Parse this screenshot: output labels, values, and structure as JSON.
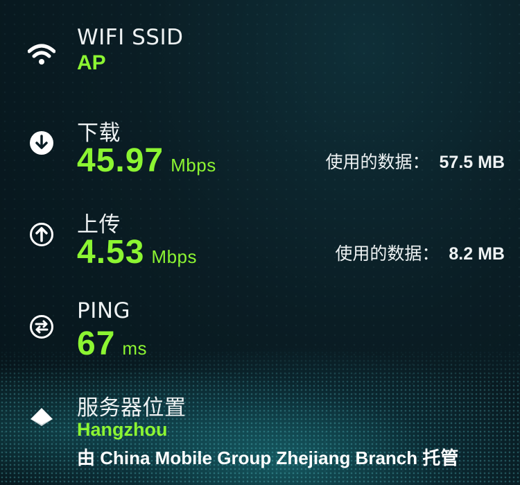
{
  "wifi": {
    "label": "WIFI SSID",
    "ssid": "AP"
  },
  "download": {
    "label": "下载",
    "value": "45.97",
    "unit": "Mbps",
    "used_label": "使用的数据：",
    "used_value": "57.5 MB"
  },
  "upload": {
    "label": "上传",
    "value": "4.53",
    "unit": "Mbps",
    "used_label": "使用的数据：",
    "used_value": "8.2 MB"
  },
  "ping": {
    "label": "PING",
    "value": "67",
    "unit": "ms"
  },
  "server": {
    "label": "服务器位置",
    "city": "Hangzhou",
    "host": "由 China Mobile Group Zhejiang Branch 托管"
  },
  "icons": {
    "wifi": "wifi-icon",
    "download": "download-arrow-icon",
    "upload": "upload-arrow-icon",
    "ping": "ping-arrows-icon",
    "server": "location-pin-icon"
  },
  "colors": {
    "accent": "#8cf532",
    "background": "#0a1d24",
    "wave": "#2bbcc6"
  }
}
